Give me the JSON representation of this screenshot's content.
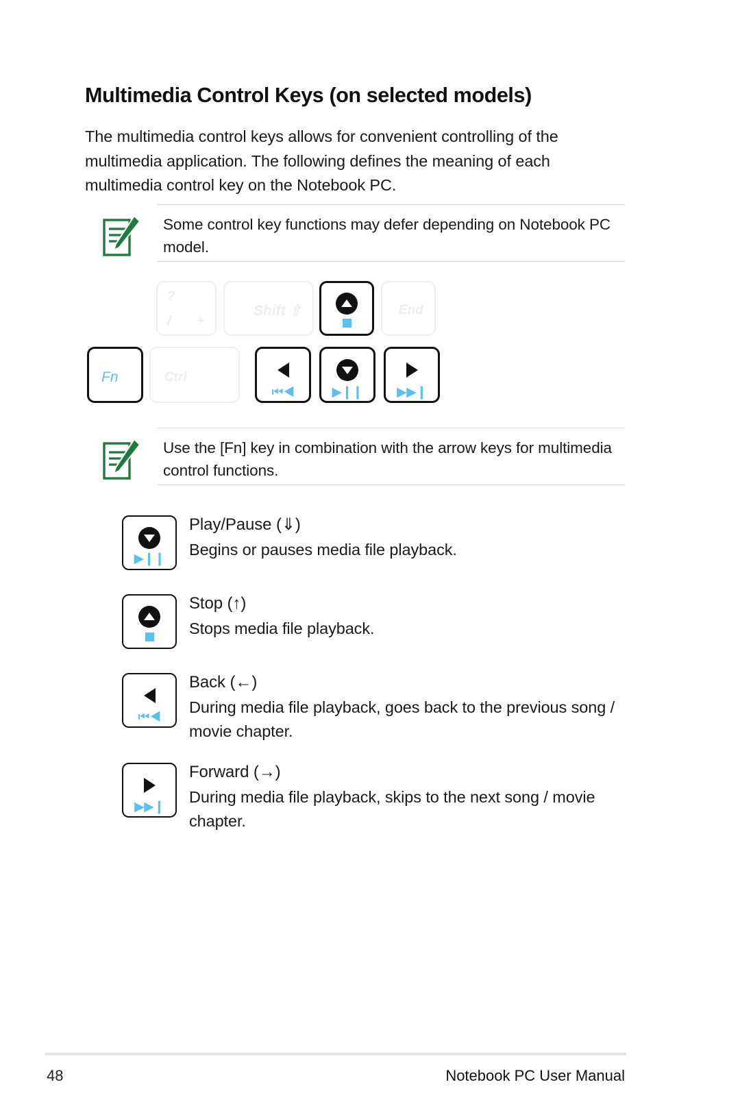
{
  "page": {
    "title": "Multimedia Control Keys (on selected models)",
    "intro": "The multimedia control keys allows for convenient controlling of the multimedia application. The following defines the meaning of each multimedia control key on the Notebook PC."
  },
  "notes": [
    {
      "icon": "note-pencil-icon",
      "text": "Some control key functions may defer depending on Notebook PC model."
    },
    {
      "icon": "note-pencil-icon",
      "text": "Use the [Fn] key in combination with the arrow keys for multimedia control functions."
    }
  ],
  "keyboard": {
    "top_row": [
      {
        "name": "question-slash-plus-key",
        "state": "ghost",
        "labels": [
          "?",
          "/",
          "+"
        ]
      },
      {
        "name": "shift-key",
        "state": "ghost",
        "labels": [
          "Shift ⇧"
        ]
      },
      {
        "name": "stop-key",
        "state": "active",
        "glyph": "circle-up-triangle",
        "media": "blue-square"
      },
      {
        "name": "end-key",
        "state": "ghost",
        "labels": [
          "End"
        ]
      }
    ],
    "bottom_row": [
      {
        "name": "fn-key",
        "state": "active",
        "labels": [
          "Fn"
        ]
      },
      {
        "name": "ctrl-key",
        "state": "ghost",
        "labels": [
          "Ctrl"
        ]
      },
      {
        "name": "back-key",
        "state": "active",
        "glyph": "left-triangle",
        "media": "⏮◀"
      },
      {
        "name": "play-pause-key",
        "state": "active",
        "glyph": "circle-down-triangle",
        "media": "▶❙❙"
      },
      {
        "name": "forward-key",
        "state": "active",
        "glyph": "right-triangle",
        "media": "▶▶❙"
      }
    ]
  },
  "entries": [
    {
      "key_name": "play-pause-key",
      "glyph": "circle-down-triangle",
      "media": "▶❙❙",
      "title": "Play/Pause (⇓)",
      "text": "Begins or pauses media file playback."
    },
    {
      "key_name": "stop-key",
      "glyph": "circle-up-triangle",
      "media": "blue-square",
      "title": "Stop (↑)",
      "text": "Stops media file playback."
    },
    {
      "key_name": "back-key",
      "glyph": "left-triangle",
      "media": "⏮◀",
      "title": "Back (←)",
      "text": "During media file playback, goes back to the previous song / movie chapter."
    },
    {
      "key_name": "forward-key",
      "glyph": "right-triangle",
      "media": "▶▶❙",
      "title": "Forward (→)",
      "text": "During media file playback, skips to the next song / movie chapter."
    }
  ],
  "footer": {
    "page_number": "48",
    "manual_title": "Notebook PC User Manual"
  },
  "colors": {
    "accent_blue": "#5bc0ec",
    "note_green": "#1f7a3d",
    "key_border": "#111111",
    "ghost_key": "#f0f0f0"
  }
}
